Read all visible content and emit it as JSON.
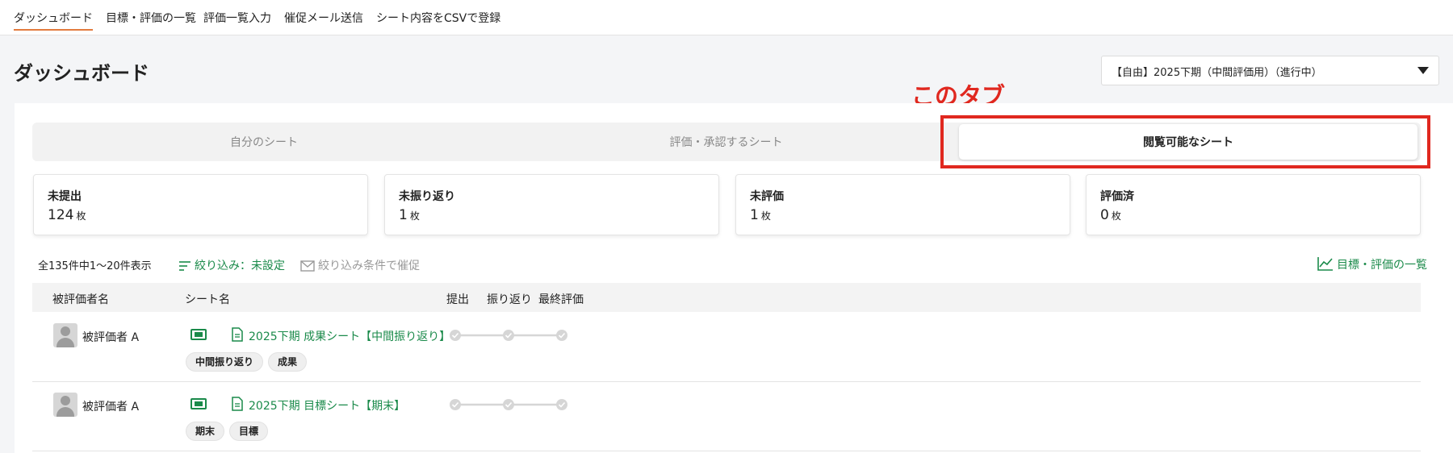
{
  "nav": {
    "items": [
      "ダッシュボード",
      "目標・評価の一覧",
      "評価一覧入力",
      "催促メール送信",
      "シート内容をCSVで登録"
    ]
  },
  "page": {
    "title": "ダッシュボード"
  },
  "period_select": {
    "value": "【自由】2025下期（中間評価用）（進行中）"
  },
  "annotation": {
    "label": "このタブ",
    "color": "#e0281f"
  },
  "tabs": [
    {
      "label": "自分のシート",
      "active": false
    },
    {
      "label": "評価・承認するシート",
      "active": false
    },
    {
      "label": "閲覧可能なシート",
      "active": true
    }
  ],
  "stats": [
    {
      "label": "未提出",
      "value": "124",
      "unit": "枚"
    },
    {
      "label": "未振り返り",
      "value": "1",
      "unit": "枚"
    },
    {
      "label": "未評価",
      "value": "1",
      "unit": "枚"
    },
    {
      "label": "評価済",
      "value": "0",
      "unit": "枚"
    }
  ],
  "list": {
    "summary": "全135件中1〜20件表示",
    "filter_label": "絞り込み：未設定",
    "remind_label": "絞り込み条件で催促",
    "list_link": "目標・評価の一覧"
  },
  "table": {
    "headers": [
      "被評価者名",
      "シート名",
      "提出",
      "振り返り",
      "最終評価"
    ],
    "rows": [
      {
        "person": "被評価者 A",
        "sheet": "2025下期 成果シート【中間振り返り】",
        "tags": [
          "中間振り返り",
          "成果"
        ]
      },
      {
        "person": "被評価者 A",
        "sheet": "2025下期 目標シート【期末】",
        "tags": [
          "期末",
          "目標"
        ]
      }
    ]
  },
  "colors": {
    "accent_green": "#1a8a4a",
    "nav_active_underline": "#e27b3e"
  }
}
